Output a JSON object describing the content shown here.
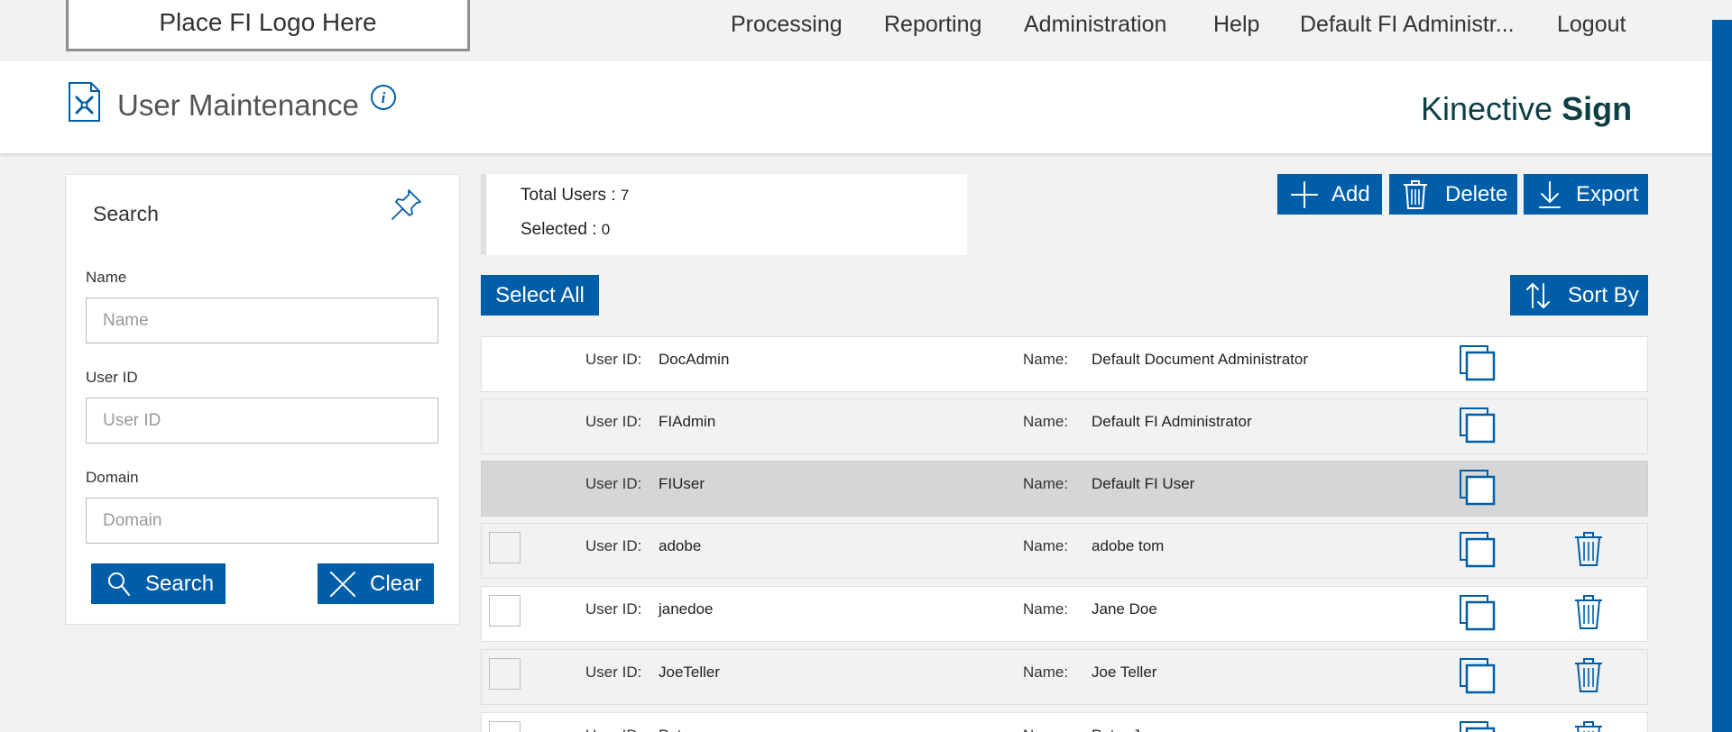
{
  "logo": {
    "text": "Place FI Logo Here"
  },
  "nav": {
    "items": [
      {
        "label": "Processing"
      },
      {
        "label": "Reporting"
      },
      {
        "label": "Administration"
      },
      {
        "label": "Help"
      },
      {
        "label": "Default FI Administr..."
      },
      {
        "label": "Logout"
      }
    ]
  },
  "header": {
    "title": "User Maintenance",
    "brand_regular": "Kinective ",
    "brand_bold": "Sign",
    "page_icon": "document-wrench-icon",
    "info_icon": "info-icon"
  },
  "search": {
    "title": "Search",
    "pin_icon": "pin-icon",
    "fields": {
      "name": {
        "label": "Name",
        "placeholder": "Name",
        "value": ""
      },
      "user_id": {
        "label": "User ID",
        "placeholder": "User ID",
        "value": ""
      },
      "domain": {
        "label": "Domain",
        "placeholder": "Domain",
        "value": ""
      }
    },
    "search_label": "Search",
    "clear_label": "Clear"
  },
  "summary": {
    "total_label": "Total Users : ",
    "total_value": "7",
    "selected_label": "Selected : ",
    "selected_value": "0"
  },
  "toolbar": {
    "add_label": "Add",
    "delete_label": "Delete",
    "export_label": "Export",
    "select_all_label": "Select All",
    "sort_by_label": "Sort By"
  },
  "list": {
    "user_id_label": "User ID:",
    "name_label": "Name:",
    "rows": [
      {
        "user_id": "DocAdmin",
        "name": "Default Document Administrator",
        "checkbox": false,
        "deletable": false,
        "state": "normal"
      },
      {
        "user_id": "FIAdmin",
        "name": "Default FI Administrator",
        "checkbox": false,
        "deletable": false,
        "state": "alt"
      },
      {
        "user_id": "FIUser",
        "name": "Default FI User",
        "checkbox": false,
        "deletable": false,
        "state": "selected"
      },
      {
        "user_id": "adobe",
        "name": "adobe tom",
        "checkbox": true,
        "deletable": true,
        "state": "alt"
      },
      {
        "user_id": "janedoe",
        "name": "Jane Doe",
        "checkbox": true,
        "deletable": true,
        "state": "normal"
      },
      {
        "user_id": "JoeTeller",
        "name": "Joe Teller",
        "checkbox": true,
        "deletable": true,
        "state": "alt"
      },
      {
        "user_id": "Peter",
        "name": "Peter Joe",
        "checkbox": true,
        "deletable": true,
        "state": "normal"
      }
    ]
  },
  "colors": {
    "accent": "#005ea8",
    "brand": "#0d3f45",
    "selected_row": "#d6d6d6"
  }
}
